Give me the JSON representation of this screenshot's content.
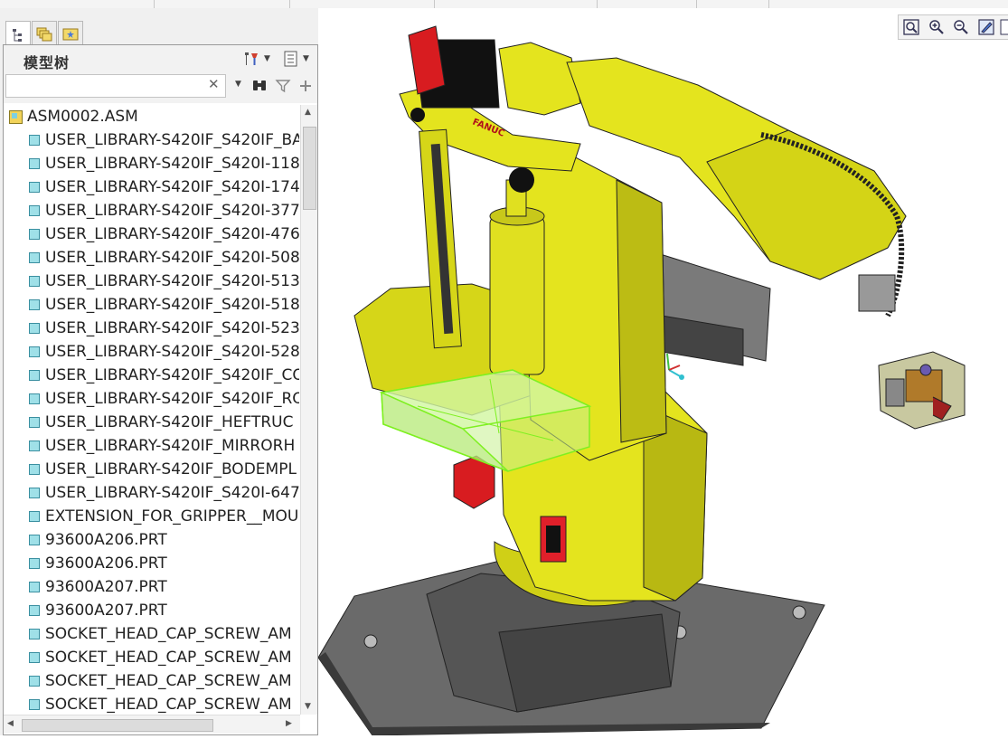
{
  "panel": {
    "tabs": [
      {
        "icon": "model-tree-icon"
      },
      {
        "icon": "layers-icon"
      },
      {
        "icon": "favorites-icon"
      }
    ],
    "title": "模型树",
    "header_buttons": [
      {
        "icon": "settings-icon"
      },
      {
        "icon": "show-list-icon"
      }
    ],
    "search": {
      "value": "",
      "placeholder": ""
    },
    "search_buttons": [
      {
        "icon": "find-binoculars-icon"
      },
      {
        "icon": "filter-icon"
      },
      {
        "icon": "add-icon"
      }
    ],
    "root": {
      "label": "ASM0002.ASM"
    },
    "items": [
      {
        "label": "USER_LIBRARY-S420IF_S420IF_BA"
      },
      {
        "label": "USER_LIBRARY-S420IF_S420I-118"
      },
      {
        "label": "USER_LIBRARY-S420IF_S420I-174"
      },
      {
        "label": "USER_LIBRARY-S420IF_S420I-377"
      },
      {
        "label": "USER_LIBRARY-S420IF_S420I-476"
      },
      {
        "label": "USER_LIBRARY-S420IF_S420I-508"
      },
      {
        "label": "USER_LIBRARY-S420IF_S420I-513"
      },
      {
        "label": "USER_LIBRARY-S420IF_S420I-518"
      },
      {
        "label": "USER_LIBRARY-S420IF_S420I-523"
      },
      {
        "label": "USER_LIBRARY-S420IF_S420I-528"
      },
      {
        "label": "USER_LIBRARY-S420IF_S420IF_CO"
      },
      {
        "label": "USER_LIBRARY-S420IF_S420IF_RO"
      },
      {
        "label": "USER_LIBRARY-S420IF_HEFTRUC"
      },
      {
        "label": "USER_LIBRARY-S420IF_MIRRORH"
      },
      {
        "label": "USER_LIBRARY-S420IF_BODEMPL"
      },
      {
        "label": "USER_LIBRARY-S420IF_S420I-647"
      },
      {
        "label": "EXTENSION_FOR_GRIPPER__MOU"
      },
      {
        "label": "93600A206.PRT"
      },
      {
        "label": "93600A206.PRT"
      },
      {
        "label": "93600A207.PRT"
      },
      {
        "label": "93600A207.PRT"
      },
      {
        "label": "SOCKET_HEAD_CAP_SCREW_AM"
      },
      {
        "label": "SOCKET_HEAD_CAP_SCREW_AM"
      },
      {
        "label": "SOCKET_HEAD_CAP_SCREW_AM"
      },
      {
        "label": "SOCKET_HEAD_CAP_SCREW_AM"
      }
    ]
  },
  "viewport": {
    "robot_logo": "FANUC",
    "toolbar": [
      {
        "icon": "refit-icon"
      },
      {
        "icon": "zoom-in-icon"
      },
      {
        "icon": "zoom-out-icon"
      },
      {
        "icon": "repaint-icon"
      }
    ],
    "colors": {
      "robot_yellow": "#e4e41e",
      "selection_green": "#7ef020",
      "base_gray": "#6a6a6a",
      "accent_red": "#e0202a"
    }
  }
}
